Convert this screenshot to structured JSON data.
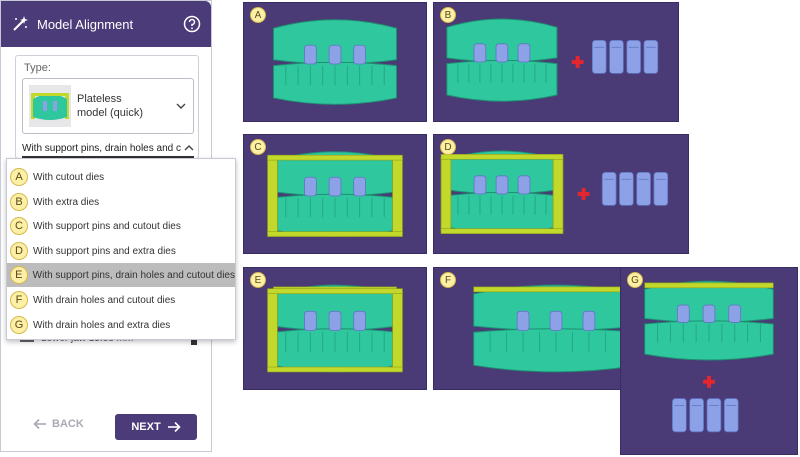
{
  "panel": {
    "title": "Model Alignment",
    "type_label": "Type:",
    "model_type_line1": "Plateless",
    "model_type_line2": "model (quick)",
    "subtype_value": "With support pins, drain holes and c",
    "lower_jaw_text": "Lower jaw 15.88 mm",
    "back_label": "BACK",
    "next_label": "NEXT"
  },
  "dropdown": {
    "selected_index": 4,
    "items": [
      {
        "letter": "A",
        "label": "With cutout dies"
      },
      {
        "letter": "B",
        "label": "With extra dies"
      },
      {
        "letter": "C",
        "label": "With support pins and cutout dies"
      },
      {
        "letter": "D",
        "label": "With support pins and extra dies"
      },
      {
        "letter": "E",
        "label": "With support pins, drain holes and cutout dies"
      },
      {
        "letter": "F",
        "label": "With drain holes and cutout dies"
      },
      {
        "letter": "G",
        "label": "With drain holes and extra dies"
      }
    ]
  },
  "tiles": [
    {
      "letter": "A"
    },
    {
      "letter": "B"
    },
    {
      "letter": "C"
    },
    {
      "letter": "D"
    },
    {
      "letter": "E"
    },
    {
      "letter": "F"
    },
    {
      "letter": "G"
    }
  ],
  "icons": {
    "header_left": "magic-wand-icon",
    "header_right": "help-icon",
    "dropdown_toggle": "chevron-down-icon",
    "subtype_toggle": "chevron-up-icon",
    "back": "arrow-left-icon",
    "next": "arrow-right-icon"
  },
  "colors": {
    "accent": "#4b3b78",
    "tile_bg": "#4a3b77",
    "model_teal": "#2fc79e",
    "die_blue": "#8da2e6",
    "pin_yellow": "#c2d92b",
    "plus_red": "#e6262d",
    "badge_yellow": "#fbf0a6",
    "selected_row": "#bcbcbc"
  }
}
